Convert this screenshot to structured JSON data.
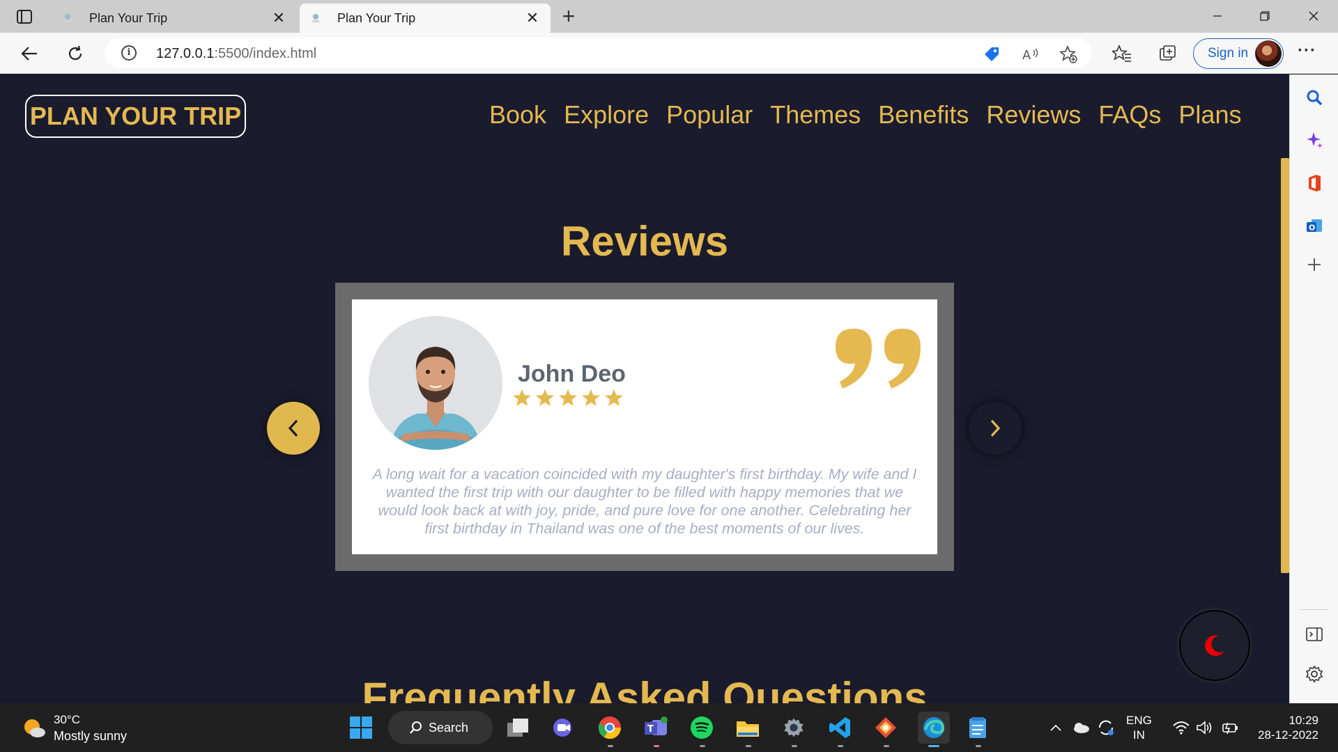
{
  "browser": {
    "tabs": [
      {
        "title": "Plan Your Trip",
        "active": false
      },
      {
        "title": "Plan Your Trip",
        "active": true
      }
    ],
    "url_host": "127.0.0.1",
    "url_path": ":5500/index.html",
    "sign_in_label": "Sign in"
  },
  "site": {
    "logo": "PLAN YOUR TRIP",
    "nav": [
      "Book",
      "Explore",
      "Popular",
      "Themes",
      "Benefits",
      "Reviews",
      "FAQs",
      "Plans"
    ],
    "accent_color": "#e4b950",
    "background_color": "#1a1b2d"
  },
  "reviews": {
    "title": "Reviews",
    "current": {
      "name": "John Deo",
      "rating": 5,
      "text": "A long wait for a vacation coincided with my daughter's first birthday. My wife and I wanted the first trip with our daughter to be filled with happy memories that we would look back at with joy, pride, and pure love for one another. Celebrating her first birthday in Thailand was one of the best moments of our lives."
    }
  },
  "faq": {
    "title": "Frequently Asked Questions"
  },
  "taskbar": {
    "weather_temp": "30°C",
    "weather_desc": "Mostly sunny",
    "search_label": "Search",
    "lang_line1": "ENG",
    "lang_line2": "IN",
    "time": "10:29",
    "date": "28-12-2022"
  }
}
